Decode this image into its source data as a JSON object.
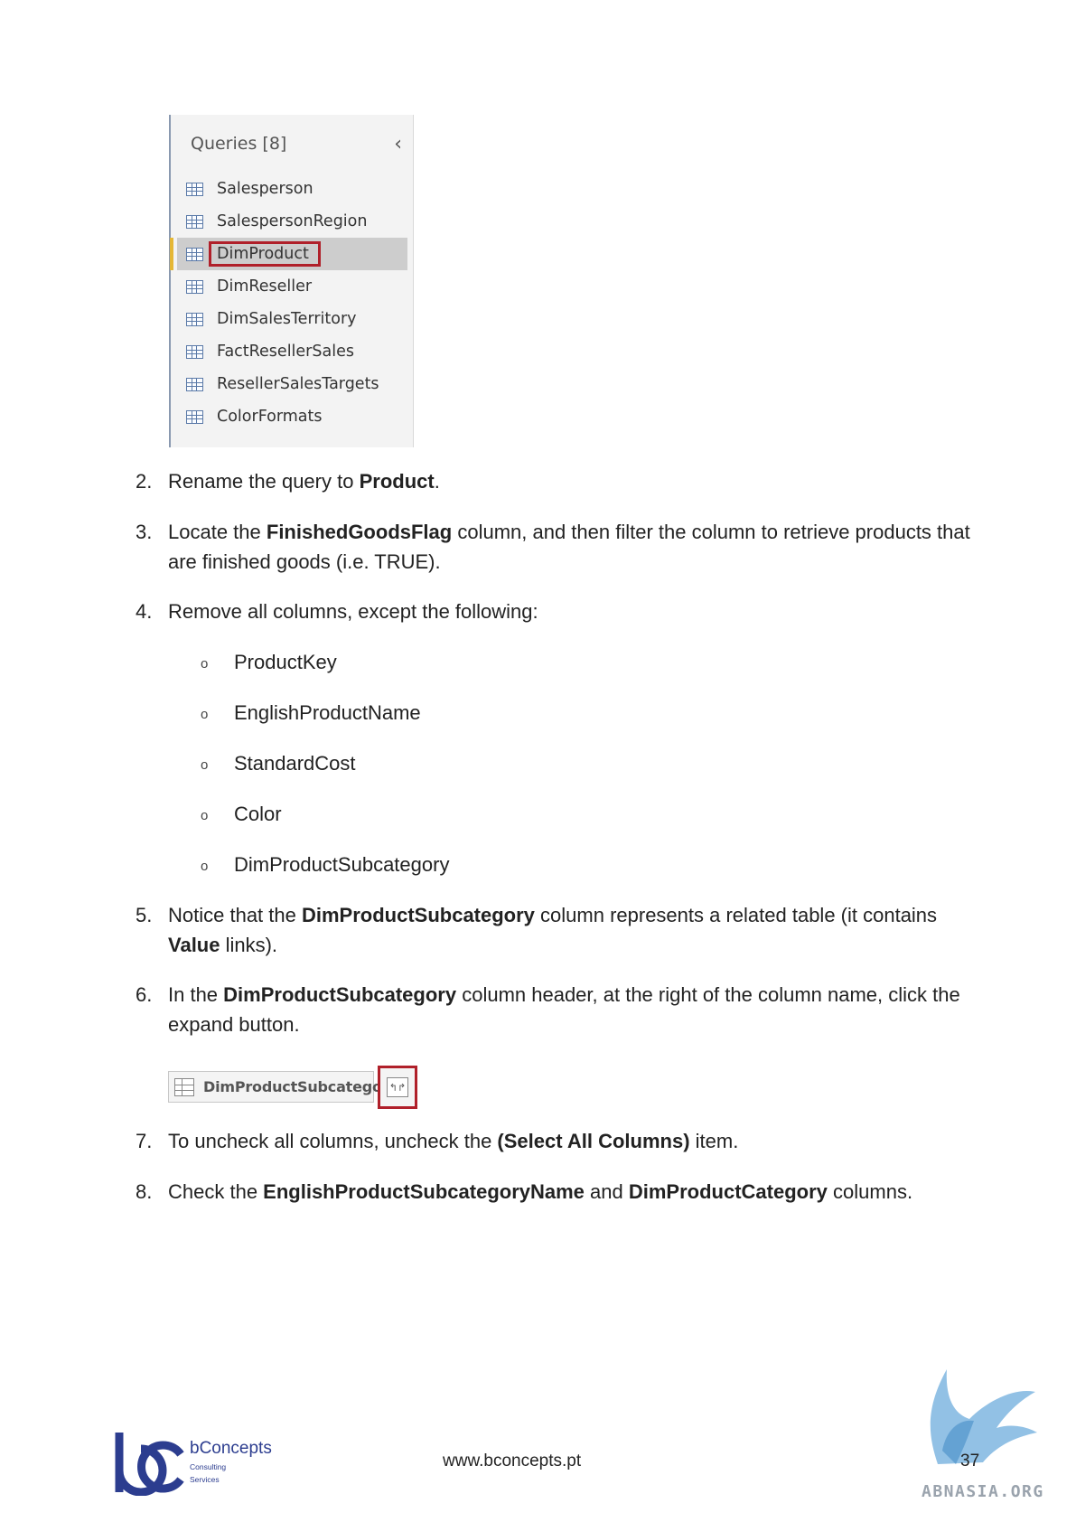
{
  "queries_panel": {
    "title": "Queries [8]",
    "items": [
      {
        "label": "Salesperson"
      },
      {
        "label": "SalespersonRegion"
      },
      {
        "label": "DimProduct",
        "selected": true
      },
      {
        "label": "DimReseller"
      },
      {
        "label": "DimSalesTerritory"
      },
      {
        "label": "FactResellerSales"
      },
      {
        "label": "ResellerSalesTargets"
      },
      {
        "label": "ColorFormats"
      }
    ]
  },
  "steps": {
    "s2": {
      "num": "2.",
      "pre": "Rename the query to ",
      "b1": "Product",
      "post": "."
    },
    "s3": {
      "num": "3.",
      "pre": "Locate the ",
      "b1": "FinishedGoodsFlag",
      "post": " column, and then filter the column to retrieve products that are finished goods (i.e. TRUE)."
    },
    "s4": {
      "num": "4.",
      "text": "Remove all columns, except the following:"
    },
    "s5": {
      "num": "5.",
      "pre": "Notice that the ",
      "b1": "DimProductSubcategory",
      "mid": " column represents a related table (it contains ",
      "b2": "Value",
      "post": " links)."
    },
    "s6": {
      "num": "6.",
      "pre": "In the ",
      "b1": "DimProductSubcategory",
      "post": " column header, at the right of the column name, click the expand button."
    },
    "s7": {
      "num": "7.",
      "pre": "To uncheck all columns, uncheck the ",
      "b1": "(Select All Columns)",
      "post": " item."
    },
    "s8": {
      "num": "8.",
      "pre": "Check the ",
      "b1": "EnglishProductSubcategoryName",
      "mid": " and ",
      "b2": "DimProductCategory",
      "post": " columns."
    }
  },
  "bullets": [
    "ProductKey",
    "EnglishProductName",
    "StandardCost",
    "Color",
    "DimProductSubcategory"
  ],
  "bullet_mark": "o",
  "column_header": {
    "name": "DimProductSubcategory",
    "expand_glyph": "↰↱"
  },
  "footer": {
    "logo_name": "bConcepts",
    "logo_sub1": "Consulting",
    "logo_sub2": "Services",
    "url": "www.bconcepts.pt",
    "page": "37",
    "watermark": "ABNASIA.ORG"
  },
  "colors": {
    "highlight_border": "#b0202a",
    "selected_accent": "#e5b735",
    "brand": "#2c3d8f"
  }
}
